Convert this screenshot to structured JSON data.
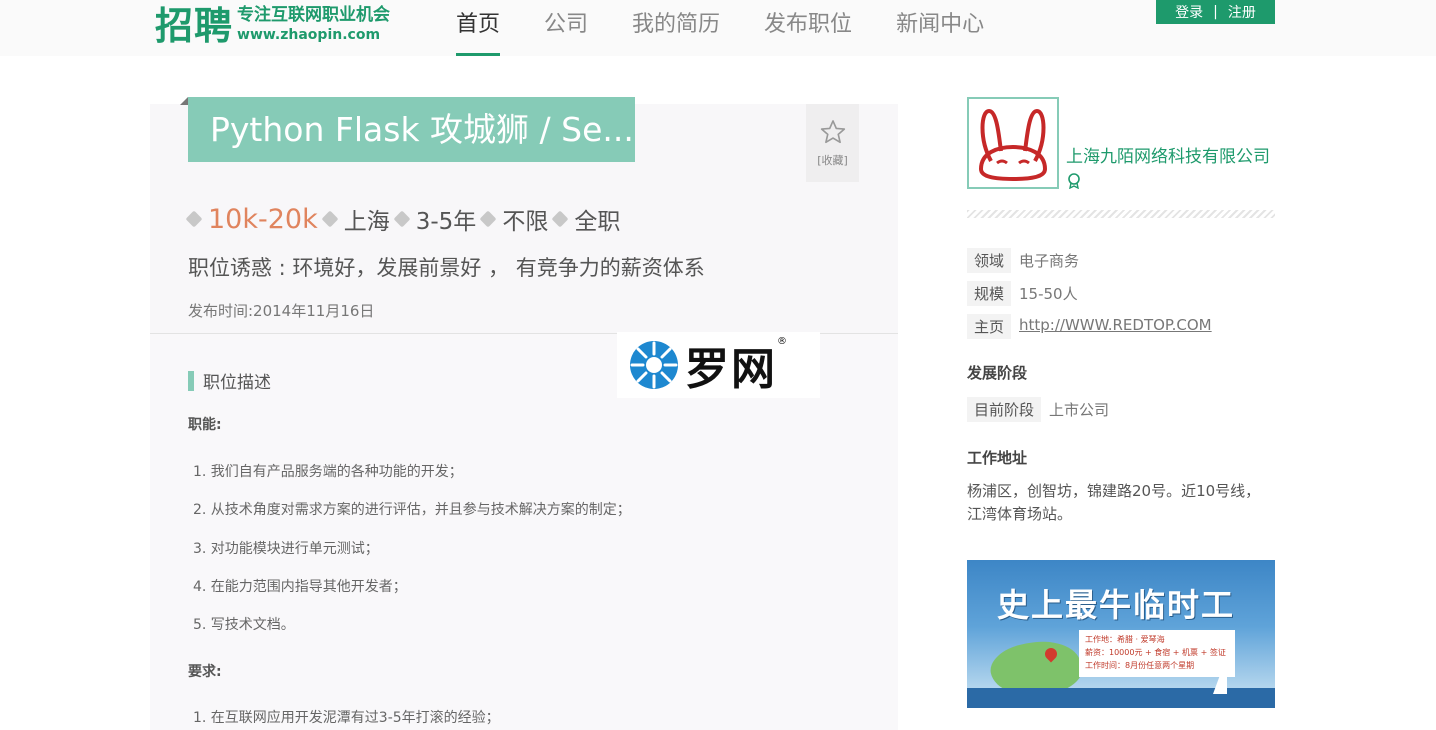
{
  "header": {
    "logo_main": "招聘",
    "logo_slogan": "专注互联网职业机会",
    "logo_url": "www.zhaopin.com",
    "nav": [
      {
        "label": "首页",
        "active": true
      },
      {
        "label": "公司",
        "active": false
      },
      {
        "label": "我的简历",
        "active": false
      },
      {
        "label": "发布职位",
        "active": false
      },
      {
        "label": "新闻中心",
        "active": false
      }
    ],
    "login_label": "登录",
    "separator": "|",
    "register_label": "注册"
  },
  "job": {
    "title": "Python Flask 攻城狮 / Se...",
    "favorite_label": "[收藏]",
    "salary": "10k-20k",
    "city": "上海",
    "experience": "3-5年",
    "education": "不限",
    "type": "全职",
    "temptation": "职位诱惑 : 环境好，发展前景好 ， 有竞争力的薪资体系",
    "publish_time": "发布时间:2014年11月16日",
    "section_title": "职位描述",
    "duties_heading": "职能:",
    "duties": [
      "1. 我们自有产品服务端的各种功能的开发；",
      "2. 从技术角度对需求方案的进行评估，并且参与技术解决方案的制定；",
      "3. 对功能模块进行单元测试；",
      "4. 在能力范围内指导其他开发者；",
      "5. 写技术文档。"
    ],
    "requirements_heading": "要求:",
    "requirements": [
      "1. 在互联网应用开发泥潭有过3-5年打滚的经验；"
    ]
  },
  "watermark": {
    "text": "罗网",
    "reg": "®"
  },
  "company": {
    "name": "上海九陌网络科技有限公司",
    "field_label": "领域",
    "field_value": "电子商务",
    "size_label": "规模",
    "size_value": "15-50人",
    "home_label": "主页",
    "home_value": "http://WWW.REDTOP.COM",
    "stage_heading": "发展阶段",
    "stage_label": "目前阶段",
    "stage_value": "上市公司",
    "address_heading": "工作地址",
    "address": "杨浦区，创智坊，锦建路20号。近10号线，江湾体育场站。"
  },
  "ad": {
    "title": "史上最牛临时工",
    "line1": "工作地：希腊 · 爱琴海",
    "line2": "薪资：10000元 + 食宿 + 机票 + 签证",
    "line3": "工作时间：8月份任意两个星期"
  },
  "colors": {
    "brand": "#1e9a6c",
    "title_bg": "#86cbb7",
    "salary": "#e0845e"
  }
}
